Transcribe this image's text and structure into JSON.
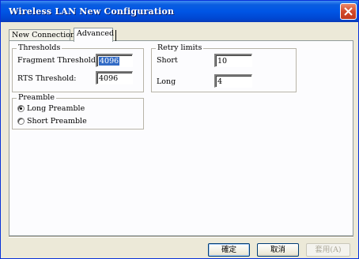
{
  "window": {
    "title": "Wireless LAN New Configuration"
  },
  "tabs": [
    {
      "label": "New Connection",
      "active": false
    },
    {
      "label": "Advanced",
      "active": true
    }
  ],
  "thresholds": {
    "legend": "Thresholds",
    "fragment_label": "Fragment Threshold:",
    "fragment_value": "4096",
    "rts_label": "RTS Threshold:",
    "rts_value": "4096"
  },
  "retry": {
    "legend": "Retry limits",
    "short_label": "Short",
    "short_value": "10",
    "long_label": "Long",
    "long_value": "4"
  },
  "preamble": {
    "legend": "Preamble",
    "long_label": "Long Preamble",
    "short_label": "Short Preamble",
    "selected": "long"
  },
  "buttons": {
    "ok": "確定",
    "cancel": "取消",
    "apply": "套用(A)"
  }
}
